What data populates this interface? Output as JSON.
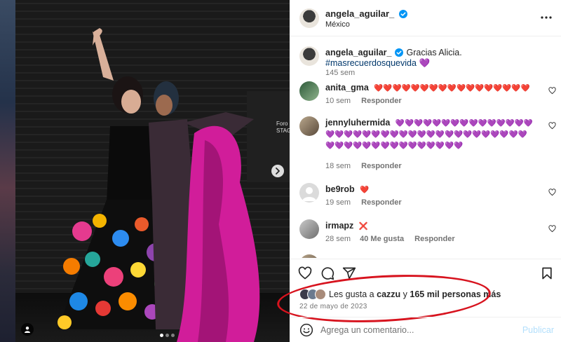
{
  "post": {
    "username": "angela_aguilar_",
    "location": "México",
    "caption_text": "Gracias Alicia.",
    "caption_hashtag": "#masrecuerdosquevida",
    "caption_emoji": "💜",
    "caption_time": "145 sem"
  },
  "media": {
    "podium_text": "Foro\nSTAGE",
    "carousel_dots": 3,
    "active_dot": 1
  },
  "comments": [
    {
      "username": "anita_gma",
      "text": "❤️❤️❤️❤️❤️❤️❤️❤️❤️❤️❤️❤️❤️❤️❤️❤️❤️",
      "time": "10 sem",
      "likes": "",
      "reply": "Responder"
    },
    {
      "username": "jennyluhermida",
      "text": "💜💜💜💜💜💜💜💜💜💜💜💜💜💜💜💜💜💜💜💜💜💜💜💜💜💜💜💜💜💜💜💜💜💜💜💜💜💜💜💜💜💜💜💜💜💜💜💜💜💜💜💜",
      "time": "18 sem",
      "likes": "",
      "reply": "Responder"
    },
    {
      "username": "be9rob",
      "text": "❤️",
      "time": "19 sem",
      "likes": "",
      "reply": "Responder"
    },
    {
      "username": "irmapz",
      "text": "❌",
      "time": "28 sem",
      "likes": "40 Me gusta",
      "reply": "Responder"
    }
  ],
  "likes": {
    "prefix": "Les gusta a",
    "user": "cazzu",
    "connector": "y",
    "count": "165 mil personas más"
  },
  "date": "22 de mayo de 2023",
  "composer": {
    "placeholder": "Agrega un comentario...",
    "publish_label": "Publicar"
  },
  "colors": {
    "verified": "#0095f6",
    "annotation": "#d7131e",
    "publish_disabled": "#b2dffc"
  },
  "icons": [
    "verified-badge-icon",
    "more-options-icon",
    "heart-icon",
    "comment-icon",
    "share-icon",
    "save-icon",
    "emoji-icon",
    "user-tag-icon",
    "chevron-right-icon"
  ]
}
